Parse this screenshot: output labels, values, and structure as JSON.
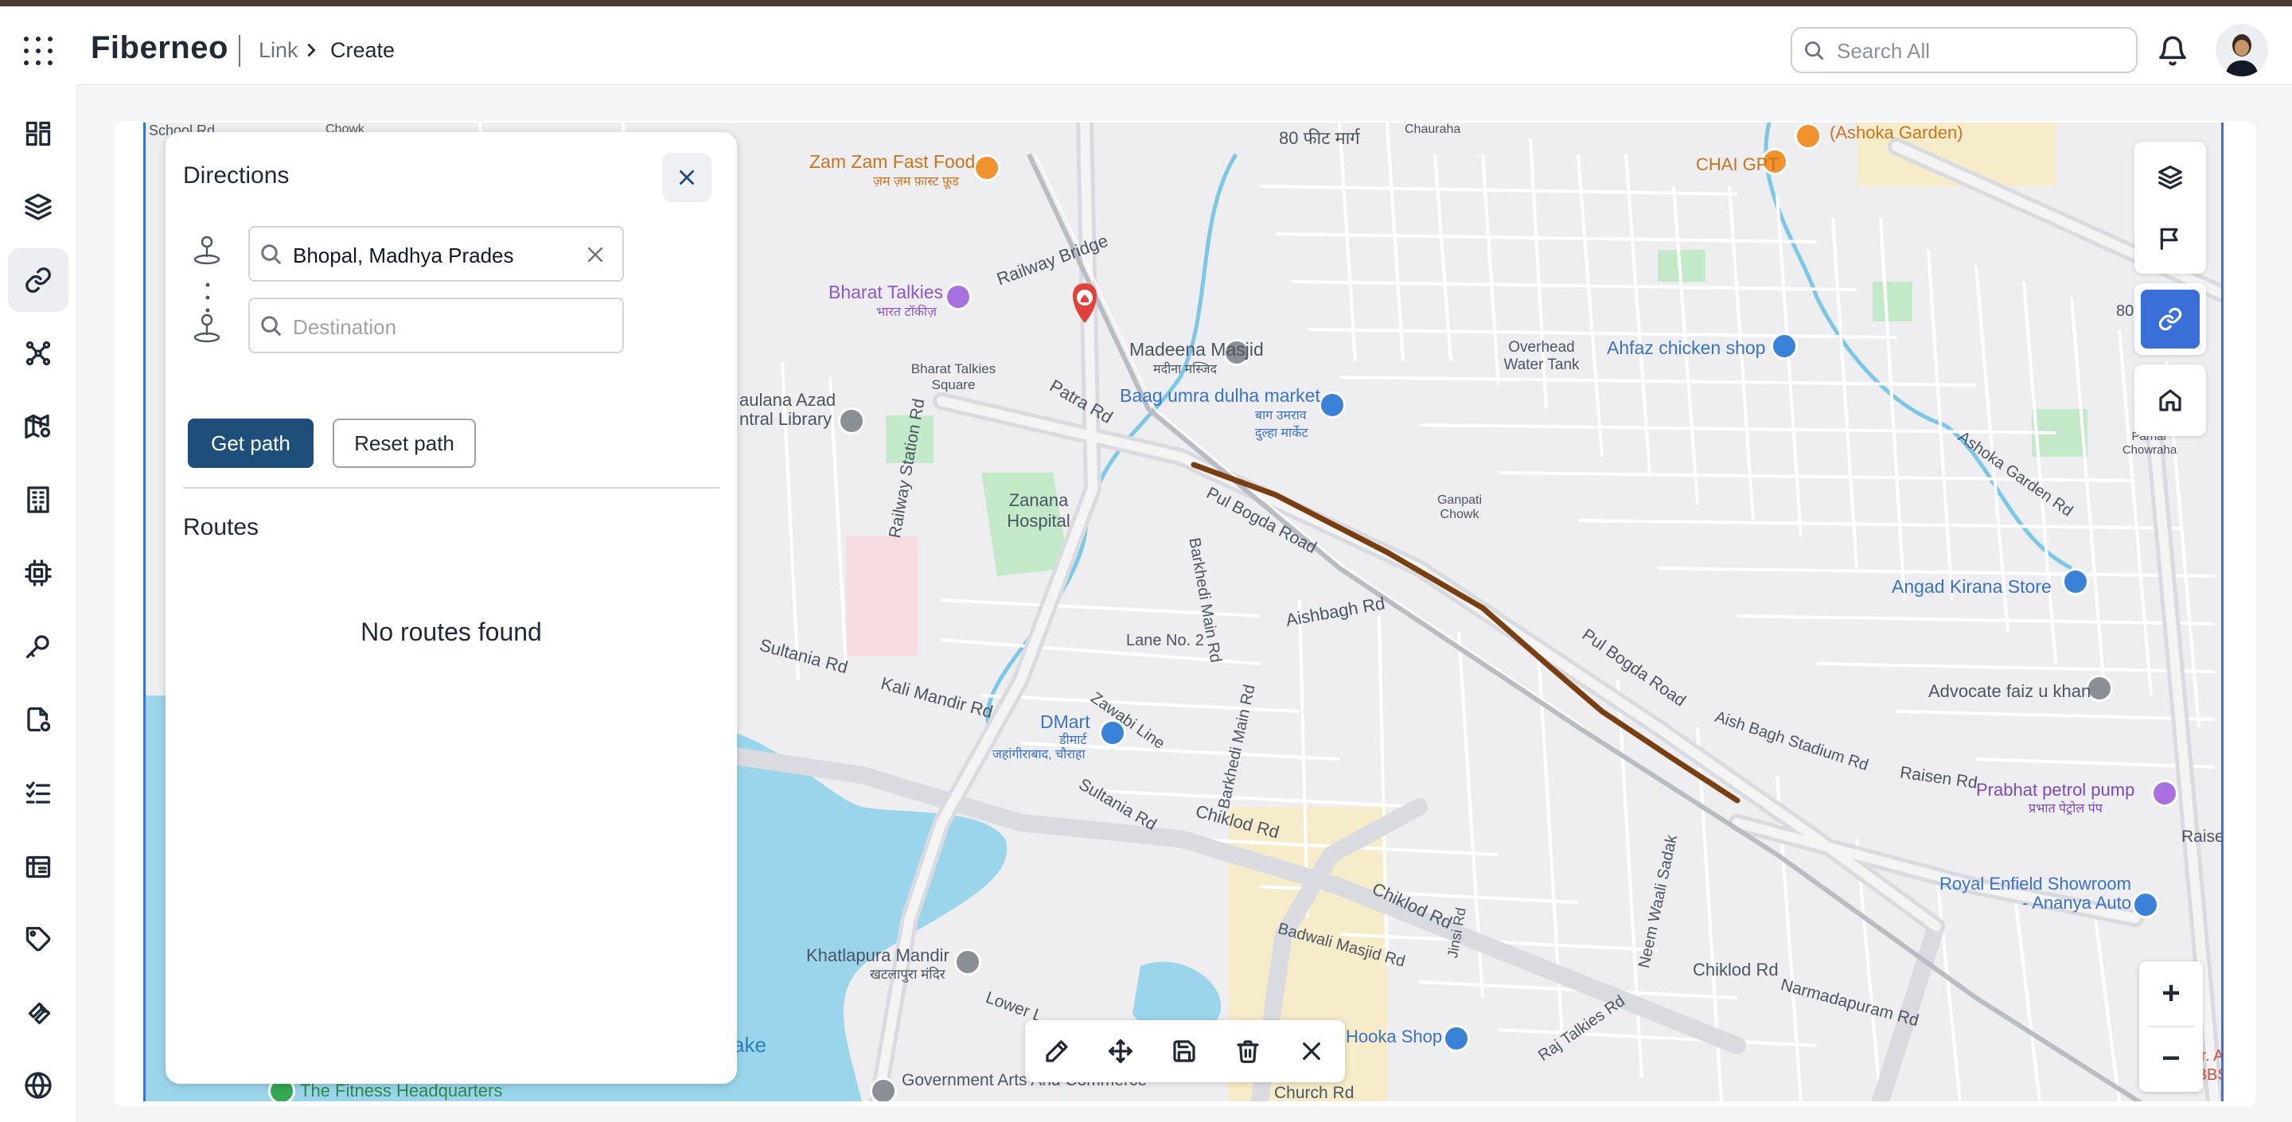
{
  "header": {
    "brand": "Fiberneo",
    "breadcrumb": {
      "parent": "Link",
      "current": "Create"
    },
    "search_placeholder": "Search All"
  },
  "sidebar": {
    "items": [
      {
        "icon": "dashboard-icon"
      },
      {
        "icon": "layers-icon"
      },
      {
        "icon": "link-icon",
        "active": true
      },
      {
        "icon": "network-icon"
      },
      {
        "icon": "map-settings-icon"
      },
      {
        "icon": "building-icon"
      },
      {
        "icon": "chip-icon"
      },
      {
        "icon": "key-icon"
      },
      {
        "icon": "document-settings-icon"
      },
      {
        "icon": "checklist-icon"
      },
      {
        "icon": "box-icon"
      },
      {
        "icon": "tag-icon"
      },
      {
        "icon": "wrench-icon"
      },
      {
        "icon": "globe-icon"
      }
    ]
  },
  "directions": {
    "title": "Directions",
    "source_value": "Bhopal, Madhya Prades",
    "destination_placeholder": "Destination",
    "get_path_label": "Get path",
    "reset_path_label": "Reset path",
    "routes_title": "Routes",
    "empty_message": "No routes found"
  },
  "map_labels": {
    "zam_zam": "Zam Zam Fast Food",
    "zam_zam_hi": "ज़म ज़म फ़ास्ट फ़ूड",
    "bharat_talkies": "Bharat Talkies",
    "bharat_talkies_hi": "भारत टॉकीज़",
    "bharat_square": "Bharat Talkies Square",
    "madeena": "Madeena Masjid",
    "madeena_hi": "मदीना मस्जिद",
    "baag_umra": "Baag umra dulha market",
    "baag_umra_hi": "बाग उमराव दुल्हा मार्केट",
    "railway_bridge": "Railway Bridge",
    "patra_rd": "Patra Rd",
    "maulana": "aulana Azad",
    "library": "ntral Library",
    "zanana": "Zanana Hospital",
    "railway_station_rd": "Railway Station Rd",
    "pul_bogda_1": "Pul Bogda Road",
    "pul_bogda_2": "Pul Bogda Road",
    "barkhedi_main_rd": "Barkhedi Main Rd",
    "barkhedi_main_rd_2": "Barkhedi Main Rd",
    "aishbagh_rd": "Aishbagh Rd",
    "lane_no2": "Lane No. 2",
    "sultania_rd": "Sultania Rd",
    "sultania_rd_2": "Sultania Rd",
    "kali_mandir_rd": "Kali Mandir Rd",
    "zawabi_line": "Zawabi Line",
    "dmart": "DMart",
    "dmart_hi": "डीमार्ट",
    "dmart_area": "जहांगीराबाद, चौराहा",
    "chiklod_rd": "Chiklod Rd",
    "chiklod_rd_2": "Chiklod Rd",
    "chiklod_rd_3": "Chiklod Rd",
    "badwali": "Badwali Masjid Rd",
    "khatlapura": "Khatlapura Mandir",
    "khatlapura_hi": "खटलापुरा मंदिर",
    "ganpati": "Ganpati Chowk",
    "overhead": "Overhead Water Tank",
    "ahfaz": "Ahfaz chicken shop",
    "chai_gpt": "CHAI GPT",
    "ashoka_garden": "(Ashoka Garden)",
    "ashoka_garden_rd": "Ashoka Garden Rd",
    "angad": "Angad Kirana Store",
    "advocate": "Advocate faiz u khan",
    "aish_bagh_stadium": "Aish Bagh Stadium Rd",
    "raisen_rd": "Raisen Rd",
    "raisen_rd_2": "Raisen",
    "prabhat": "Prabhat petrol pump",
    "prabhat_hi": "प्रभात पेट्रोल पंप",
    "royal_enfield": "Royal Enfield Showroom",
    "royal_enfield_2": "- Ananya Auto",
    "neem_waali": "Neem Waali Sadak",
    "narmadapuram": "Narmadapuram Rd",
    "raj_talkies": "Raj Talkies Rd",
    "jinsi_rd": "Jinsi Rd",
    "hooka_shop": "Hooka Shop",
    "fitness": "The Fitness Headquarters",
    "govt_arts": "Government Arts And Commerce",
    "lower_lake": "Lower L",
    "lake": "ake",
    "church_rd": "Church Rd",
    "eighty_feet": "80 फीट मार्ग",
    "school_rd": "School Rd",
    "chowk": "Chowk",
    "chauraha": "Chauraha",
    "dr_a": "Dr. A",
    "mbbs": "MBBS,",
    "parnar": "Parnar Chowraha",
    "eighty": "80"
  },
  "map": {
    "route_color": "#7a3f10",
    "water_color": "#9bd5ec",
    "park_color": "#c4e9c8"
  },
  "toolbar": {
    "tools": [
      "pencil-icon",
      "move-icon",
      "save-icon",
      "trash-icon",
      "close-icon"
    ]
  },
  "zoom": {
    "in": "+",
    "out": "−"
  }
}
